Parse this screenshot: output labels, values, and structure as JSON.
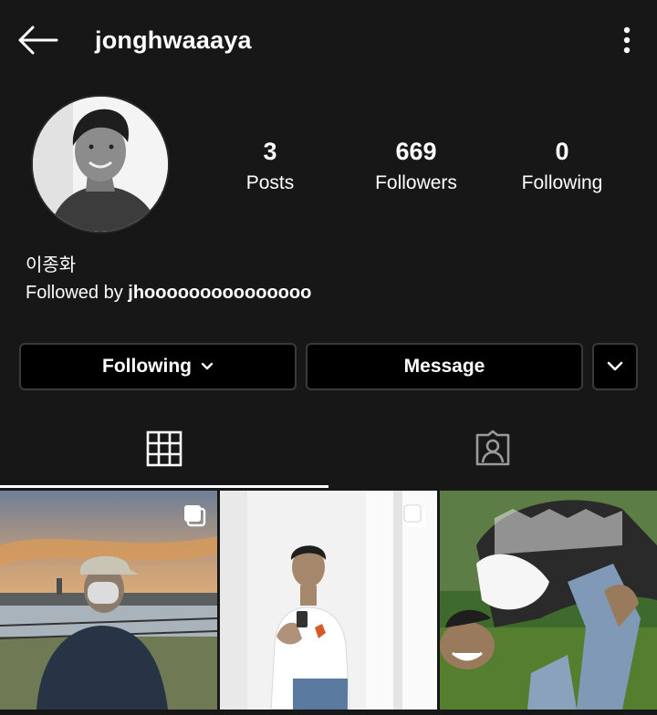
{
  "header": {
    "username": "jonghwaaaya"
  },
  "profile": {
    "full_name": "이종화",
    "followed_by_prefix": "Followed by ",
    "followed_by_user": "jhooooooooooooooo"
  },
  "stats": {
    "posts_count": "3",
    "posts_label": "Posts",
    "followers_count": "669",
    "followers_label": "Followers",
    "following_count": "0",
    "following_label": "Following"
  },
  "actions": {
    "following_label": "Following",
    "message_label": "Message"
  },
  "tabs": [
    {
      "icon": "grid-icon",
      "active": true
    },
    {
      "icon": "tagged-person-icon",
      "active": false
    }
  ],
  "posts": [
    {
      "icon": "multi-photo-icon",
      "scene": "man in cap and mask by river at sunset"
    },
    {
      "icon": "multi-photo-icon",
      "scene": "man leaning on white wall looking at phone"
    },
    {
      "icon": "none",
      "scene": "man bending backwards laughing on grass"
    }
  ],
  "colors": {
    "background": "#171717",
    "button_bg": "#000000",
    "button_border": "#3a3a3a",
    "text": "#ffffff",
    "active_tab_indicator": "#ffffff"
  }
}
